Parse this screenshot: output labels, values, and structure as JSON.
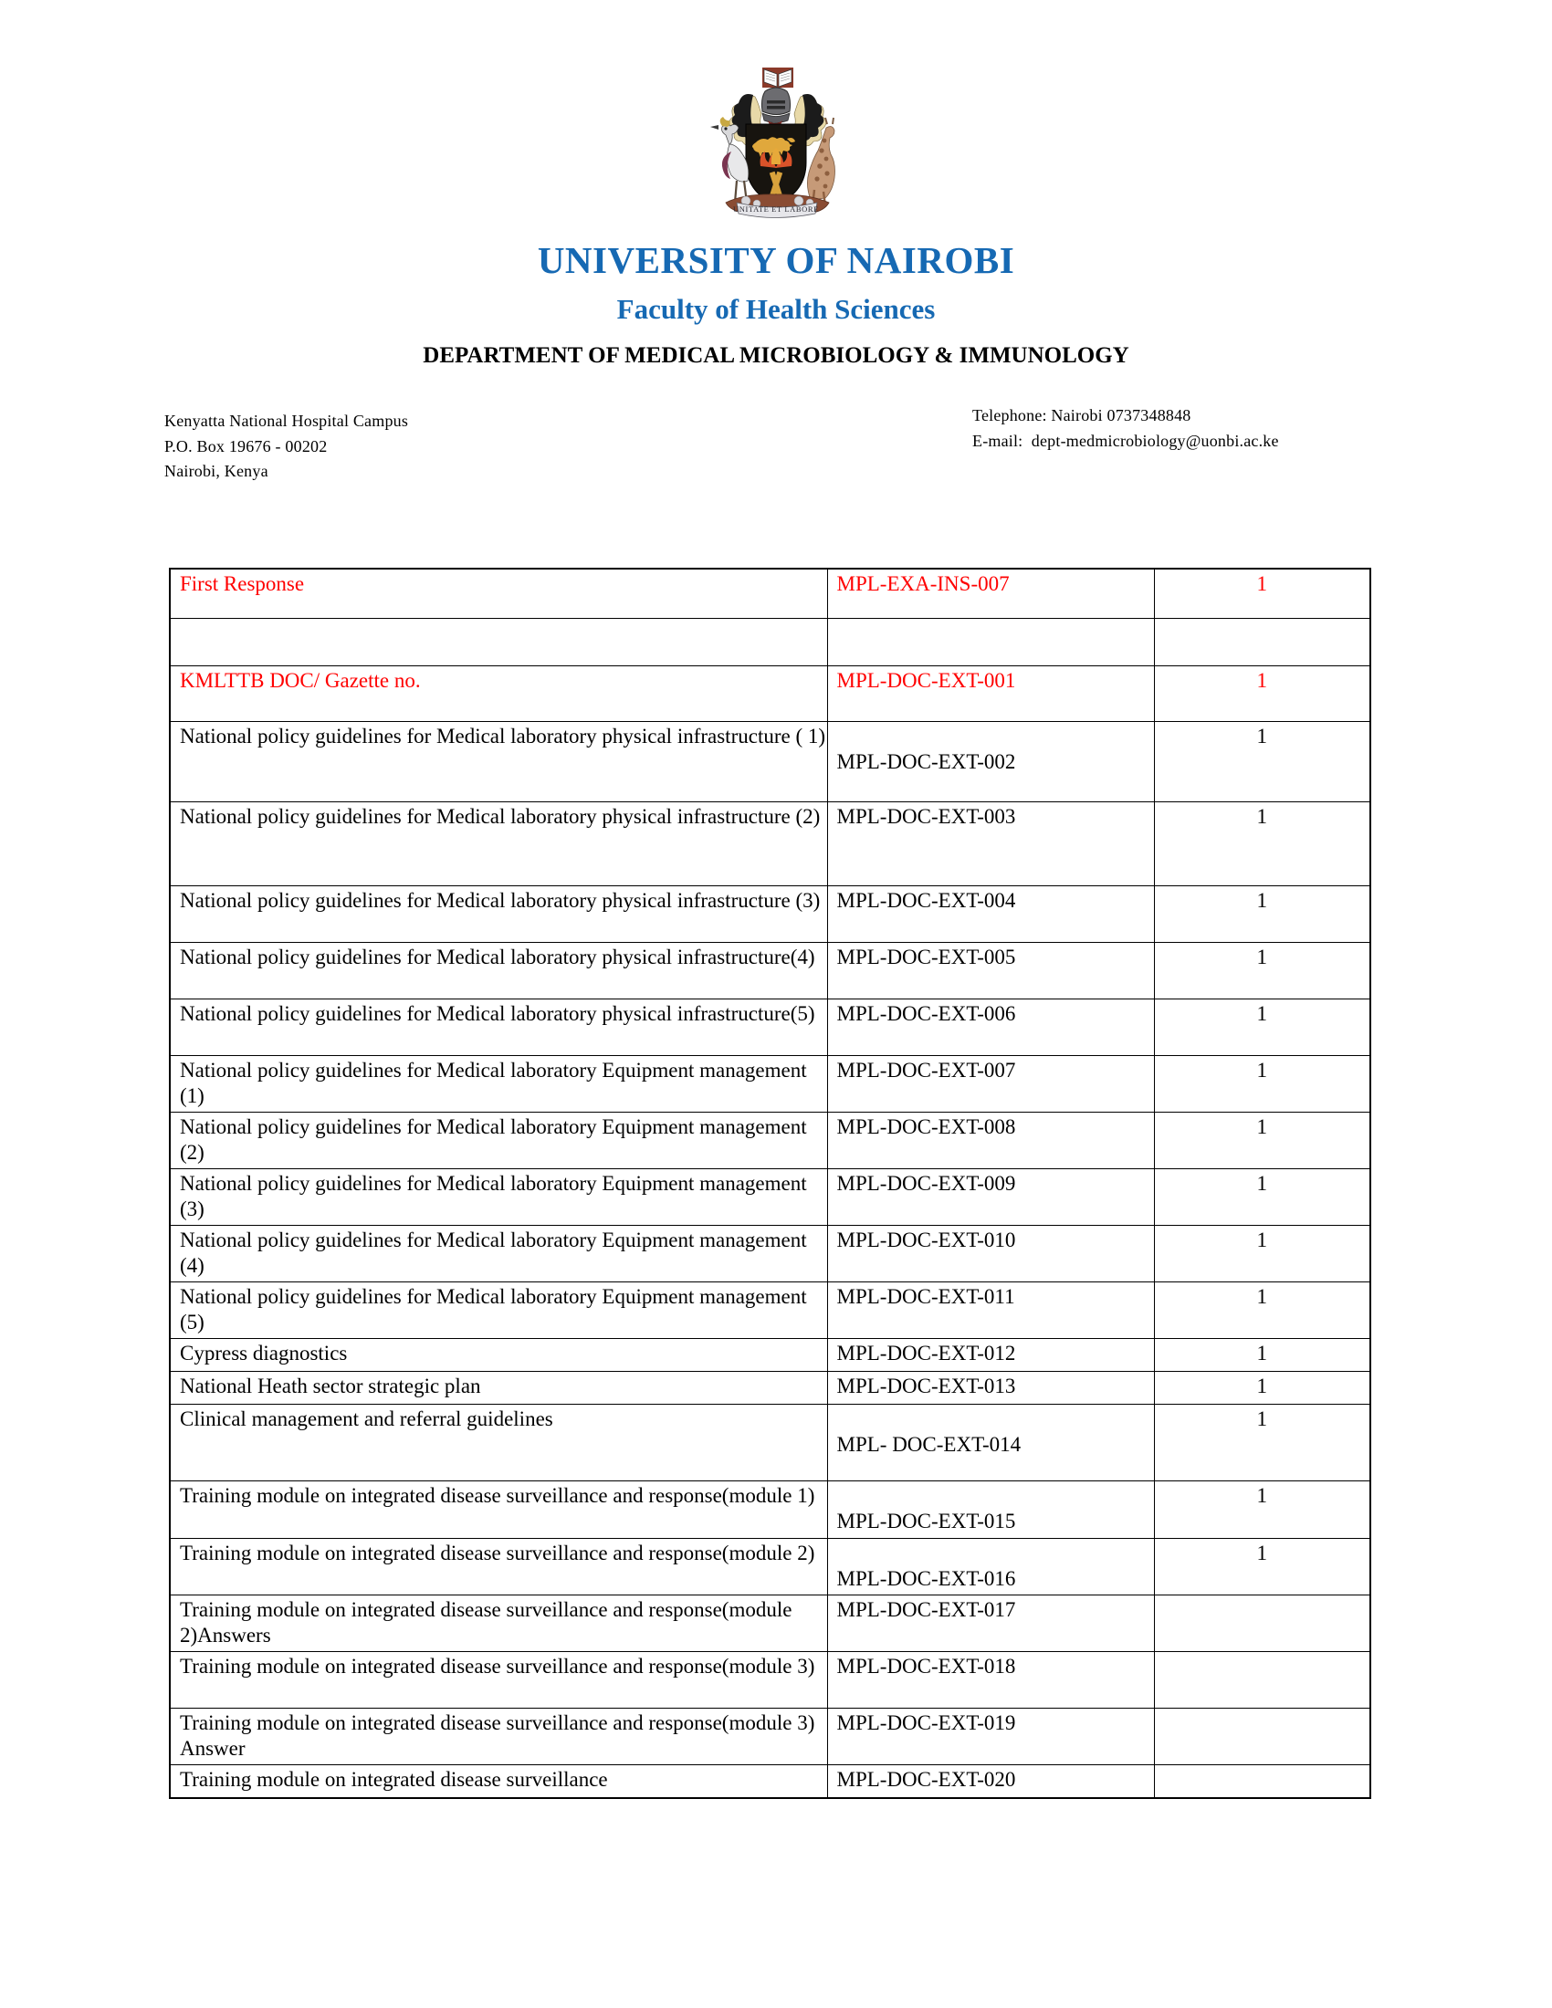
{
  "header": {
    "crest_alt": "university-coat-of-arms",
    "university": "UNIVERSITY  OF NAIROBI",
    "faculty": "Faculty of Health Sciences",
    "department": "DEPARTMENT OF MEDICAL MICROBIOLOGY & IMMUNOLOGY",
    "accent_color": "#1669b3",
    "highlight_color": "#ff0000"
  },
  "contact": {
    "address": [
      "Kenyatta National Hospital Campus",
      "P.O. Box 19676 - 00202",
      "Nairobi, Kenya"
    ],
    "telephone": "Telephone: Nairobi 0737348848",
    "email": "E-mail:  dept-medmicrobiology@uonbi.ac.ke"
  },
  "table": {
    "rows": [
      {
        "title": "First Response",
        "code": "MPL-EXA-INS-007",
        "qty": "1",
        "red": true,
        "size": "t1",
        "code_second_line": false,
        "qty_second_line": false
      },
      {
        "title": "",
        "code": "",
        "qty": "",
        "red": false,
        "size": "t2",
        "code_second_line": false,
        "qty_second_line": false
      },
      {
        "title": "KMLTTB   DOC/ Gazette no.",
        "code": "MPL-DOC-EXT-001",
        "qty": "1",
        "red": true,
        "size": "t3",
        "code_second_line": false,
        "qty_second_line": false
      },
      {
        "title": "National policy guidelines for Medical laboratory physical infrastructure ( 1)",
        "code": "MPL-DOC-EXT-002",
        "qty": "1",
        "red": false,
        "size": "t4",
        "code_second_line": true,
        "qty_second_line": true
      },
      {
        "title": "National policy guidelines for Medical laboratory physical infrastructure (2)",
        "code": "MPL-DOC-EXT-003",
        "qty": "1",
        "red": false,
        "size": "t5",
        "code_second_line": false,
        "qty_second_line": false
      },
      {
        "title": "National policy guidelines for Medical laboratory physical infrastructure (3)",
        "code": "MPL-DOC-EXT-004",
        "qty": "1",
        "red": false,
        "size": "t6",
        "code_second_line": false,
        "qty_second_line": false
      },
      {
        "title": "National policy guidelines for Medical laboratory physical infrastructure(4)",
        "code": "MPL-DOC-EXT-005",
        "qty": "1",
        "red": false,
        "size": "t6",
        "code_second_line": false,
        "qty_second_line": false
      },
      {
        "title": "National policy guidelines for Medical laboratory physical infrastructure(5)",
        "code": "MPL-DOC-EXT-006",
        "qty": "1",
        "red": false,
        "size": "t6",
        "code_second_line": false,
        "qty_second_line": false
      },
      {
        "title": "National policy guidelines for Medical laboratory Equipment  management  (1)",
        "code": "MPL-DOC-EXT-007",
        "qty": "1",
        "red": false,
        "size": "t6",
        "code_second_line": false,
        "qty_second_line": false
      },
      {
        "title": "National policy guidelines for Medical laboratory Equipment  management  (2)",
        "code": "MPL-DOC-EXT-008",
        "qty": "1",
        "red": false,
        "size": "t6",
        "code_second_line": false,
        "qty_second_line": false
      },
      {
        "title": "National policy guidelines for Medical laboratory Equipment  management  (3)",
        "code": "MPL-DOC-EXT-009",
        "qty": "1",
        "red": false,
        "size": "t6",
        "code_second_line": false,
        "qty_second_line": false
      },
      {
        "title": "National policy guidelines for Medical laboratory Equipment  management  (4)",
        "code": "MPL-DOC-EXT-010",
        "qty": "1",
        "red": false,
        "size": "t6",
        "code_second_line": false,
        "qty_second_line": false
      },
      {
        "title": "National policy guidelines for Medical laboratory Equipment  management  (5)",
        "code": "MPL-DOC-EXT-011",
        "qty": "1",
        "red": false,
        "size": "t6",
        "code_second_line": false,
        "qty_second_line": false
      },
      {
        "title": "Cypress diagnostics",
        "code": "MPL-DOC-EXT-012",
        "qty": "1",
        "red": false,
        "size": "t7",
        "code_second_line": false,
        "qty_second_line": false
      },
      {
        "title": "National Heath sector strategic plan",
        "code": "MPL-DOC-EXT-013",
        "qty": "1",
        "red": false,
        "size": "t7",
        "code_second_line": false,
        "qty_second_line": false
      },
      {
        "title": "Clinical management  and referral guidelines",
        "code": "MPL-  DOC-EXT-014",
        "qty": "1",
        "red": false,
        "size": "t8",
        "code_second_line": true,
        "qty_second_line": false
      },
      {
        "title": "Training module on integrated disease surveillance and response(module 1)",
        "code": "MPL-DOC-EXT-015",
        "qty": "1",
        "red": false,
        "size": "t6",
        "code_second_line": true,
        "qty_second_line": true
      },
      {
        "title": "Training module on integrated disease surveillance and response(module 2)",
        "code": "MPL-DOC-EXT-016",
        "qty": "1",
        "red": false,
        "size": "t6",
        "code_second_line": true,
        "qty_second_line": false
      },
      {
        "title": "Training module on integrated disease surveillance and response(module 2)Answers",
        "code": "MPL-DOC-EXT-017",
        "qty": "",
        "red": false,
        "size": "t6",
        "code_second_line": false,
        "qty_second_line": false
      },
      {
        "title": "Training module on integrated disease surveillance and response(module 3)",
        "code": "MPL-DOC-EXT-018",
        "qty": "",
        "red": false,
        "size": "t6",
        "code_second_line": false,
        "qty_second_line": false
      },
      {
        "title": "Training module on integrated disease surveillance and response(module 3) Answer",
        "code": "MPL-DOC-EXT-019",
        "qty": "",
        "red": false,
        "size": "t6",
        "code_second_line": false,
        "qty_second_line": false
      },
      {
        "title": "Training module on integrated disease surveillance",
        "code": "MPL-DOC-EXT-020",
        "qty": "",
        "red": false,
        "size": "t7",
        "code_second_line": false,
        "qty_second_line": false
      }
    ]
  }
}
